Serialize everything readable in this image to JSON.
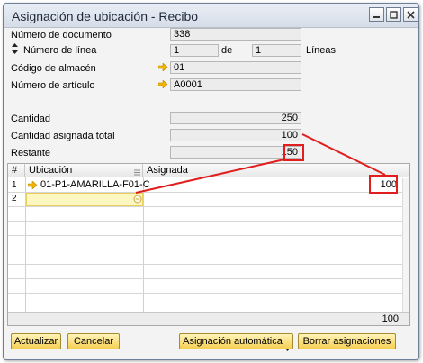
{
  "window": {
    "title": "Asignación de ubicación - Recibo"
  },
  "header": {
    "document_number_label": "Número de documento",
    "document_number": "338",
    "line_number_label": "Número de línea",
    "line_current": "1",
    "line_of": "de",
    "line_total": "1",
    "lines_label": "Líneas",
    "warehouse_label": "Código de almacén",
    "warehouse_code": "01",
    "item_label": "Número de artículo",
    "item_code": "A0001"
  },
  "quantities": {
    "quantity_label": "Cantidad",
    "quantity": "250",
    "assigned_total_label": "Cantidad asignada total",
    "assigned_total": "100",
    "remaining_label": "Restante",
    "remaining": "150"
  },
  "grid": {
    "columns": [
      "#",
      "Ubicación",
      "Asignada"
    ],
    "rows": [
      {
        "num": "1",
        "location": "01-P1-AMARILLA-F01-C",
        "assigned": "100"
      },
      {
        "num": "2",
        "location": "",
        "assigned": ""
      }
    ],
    "footer_total": "100"
  },
  "buttons": {
    "update": "Actualizar",
    "cancel": "Cancelar",
    "auto_assign": "Asignación automática",
    "clear_assign": "Borrar asignaciones"
  },
  "colors": {
    "highlight": "#e11d1d",
    "button_gold": "#f5cf52",
    "link_arrow": "#f2b500",
    "row_select": "#fff7c2"
  }
}
